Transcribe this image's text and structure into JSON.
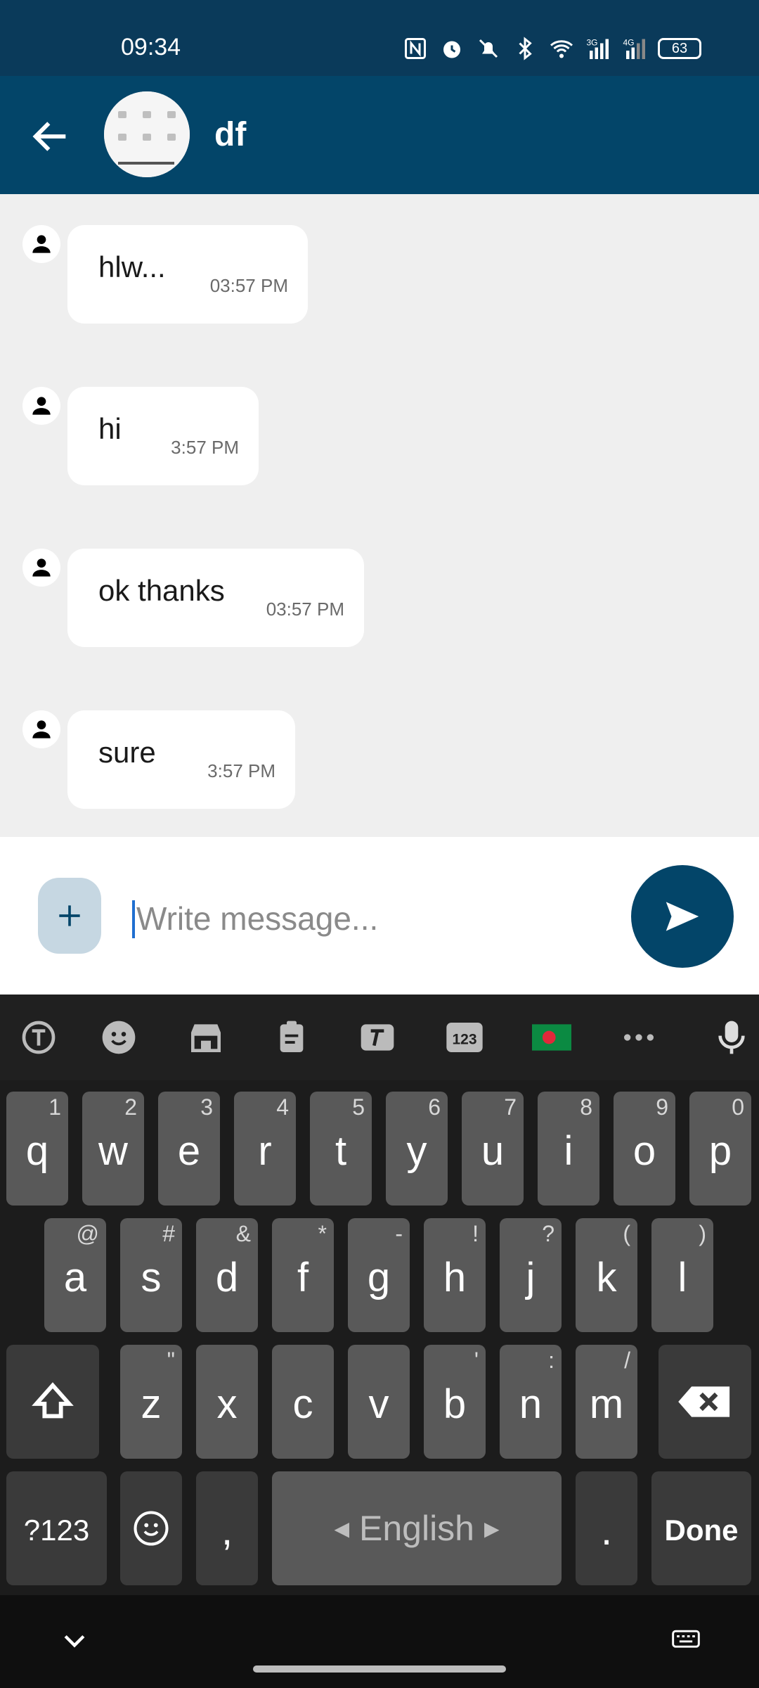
{
  "status_bar": {
    "time": "09:34",
    "battery": "63",
    "signal_labels": [
      "3G",
      "4G"
    ]
  },
  "header": {
    "title": "df"
  },
  "messages": [
    {
      "text": "hlw...",
      "time": "03:57 PM"
    },
    {
      "text": "hi",
      "time": "3:57 PM"
    },
    {
      "text": "ok thanks",
      "time": "03:57 PM"
    },
    {
      "text": "sure",
      "time": "3:57 PM"
    }
  ],
  "composer": {
    "placeholder": "Write message..."
  },
  "keyboard": {
    "number_key": "123",
    "row1": [
      {
        "k": "q",
        "h": "1"
      },
      {
        "k": "w",
        "h": "2"
      },
      {
        "k": "e",
        "h": "3"
      },
      {
        "k": "r",
        "h": "4"
      },
      {
        "k": "t",
        "h": "5"
      },
      {
        "k": "y",
        "h": "6"
      },
      {
        "k": "u",
        "h": "7"
      },
      {
        "k": "i",
        "h": "8"
      },
      {
        "k": "o",
        "h": "9"
      },
      {
        "k": "p",
        "h": "0"
      }
    ],
    "row2": [
      {
        "k": "a",
        "h": "@"
      },
      {
        "k": "s",
        "h": "#"
      },
      {
        "k": "d",
        "h": "&"
      },
      {
        "k": "f",
        "h": "*"
      },
      {
        "k": "g",
        "h": "-"
      },
      {
        "k": "h",
        "h": "!"
      },
      {
        "k": "j",
        "h": "?"
      },
      {
        "k": "k",
        "h": "("
      },
      {
        "k": "l",
        "h": ")"
      }
    ],
    "row3": [
      {
        "k": "z",
        "h": "\""
      },
      {
        "k": "x",
        "h": ""
      },
      {
        "k": "c",
        "h": ""
      },
      {
        "k": "v",
        "h": ""
      },
      {
        "k": "b",
        "h": "'"
      },
      {
        "k": "n",
        "h": ":"
      },
      {
        "k": "m",
        "h": "/"
      }
    ],
    "symbols_label": "?123",
    "comma": ",",
    "space_label": "English",
    "period": ".",
    "done_label": "Done"
  },
  "colors": {
    "primary": "#034569",
    "status_bar": "#0a3a5a",
    "accent_light": "#c6d7e2"
  }
}
